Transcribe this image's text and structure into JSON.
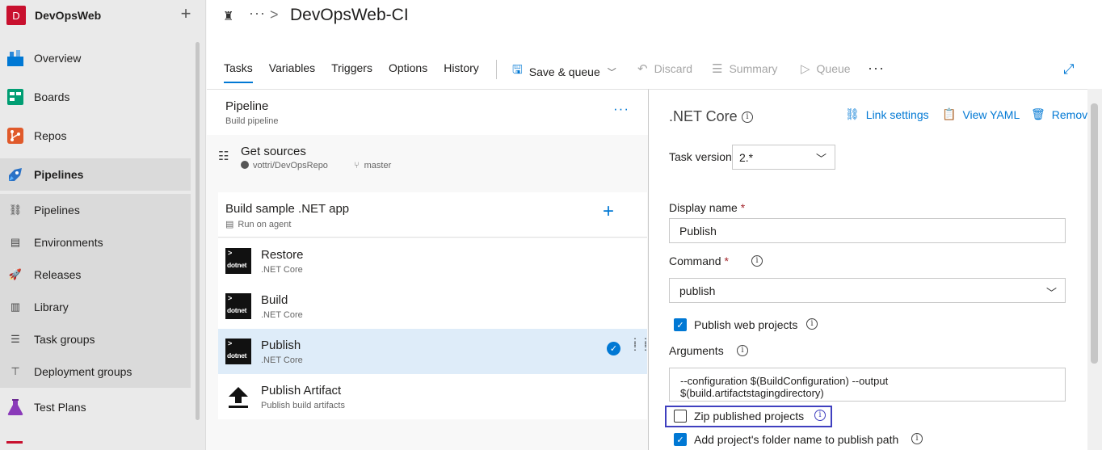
{
  "org": {
    "badge": "D",
    "name": "DevOpsWeb",
    "add": "+"
  },
  "nav": [
    {
      "label": "Overview",
      "icon": "overview-icon",
      "color": "#0078d4"
    },
    {
      "label": "Boards",
      "icon": "boards-icon",
      "color": "#009e73"
    },
    {
      "label": "Repos",
      "icon": "repos-icon",
      "color": "#e05a2b"
    },
    {
      "label": "Pipelines",
      "icon": "pipelines-icon",
      "color": "#2a72c6"
    },
    {
      "label": "Test Plans",
      "icon": "test-plans-icon",
      "color": "#8a3ab9"
    }
  ],
  "subnav": [
    {
      "label": "Pipelines",
      "icon": "pipelines-sub-icon"
    },
    {
      "label": "Environments",
      "icon": "environments-icon"
    },
    {
      "label": "Releases",
      "icon": "releases-icon"
    },
    {
      "label": "Library",
      "icon": "library-icon"
    },
    {
      "label": "Task groups",
      "icon": "task-groups-icon"
    },
    {
      "label": "Deployment groups",
      "icon": "deployment-groups-icon"
    }
  ],
  "header": {
    "more": "···",
    "chevron": ">",
    "title": "DevOpsWeb-CI",
    "tabs": [
      "Tasks",
      "Variables",
      "Triggers",
      "Options",
      "History"
    ],
    "active_tab": "Tasks",
    "save_queue": "Save & queue",
    "discard": "Discard",
    "summary": "Summary",
    "queue": "Queue",
    "toolbar_more": "···"
  },
  "pipeline": {
    "title": "Pipeline",
    "subtitle": "Build pipeline",
    "more": "···",
    "sources_title": "Get sources",
    "repo": "vottri/DevOpsRepo",
    "branch": "master"
  },
  "job": {
    "title": "Build sample .NET app",
    "subtitle": "Run on agent",
    "add": "+"
  },
  "tasks": [
    {
      "name": "Restore",
      "sub": ".NET Core",
      "logo": "dotnet"
    },
    {
      "name": "Build",
      "sub": ".NET Core",
      "logo": "dotnet"
    },
    {
      "name": "Publish",
      "sub": ".NET Core",
      "logo": "dotnet",
      "selected": true
    },
    {
      "name": "Publish Artifact",
      "sub": "Publish build artifacts",
      "logo": "upload-icon"
    }
  ],
  "details": {
    "title": ".NET Core",
    "link_settings": "Link settings",
    "view_yaml": "View YAML",
    "remove": "Remove",
    "task_version_label": "Task version",
    "task_version": "2.*",
    "display_name_label": "Display name",
    "display_name": "Publish",
    "command_label": "Command",
    "command": "publish",
    "publish_web_label": "Publish web projects",
    "publish_web_checked": true,
    "arguments_label": "Arguments",
    "arguments_line1": "--configuration $(BuildConfiguration) --output",
    "arguments_line2": "$(build.artifactstagingdirectory)",
    "zip_label": "Zip published projects",
    "zip_checked": false,
    "add_folder_label": "Add project's folder name to publish path",
    "add_folder_checked": true,
    "required_mark": "*",
    "info": "i"
  }
}
